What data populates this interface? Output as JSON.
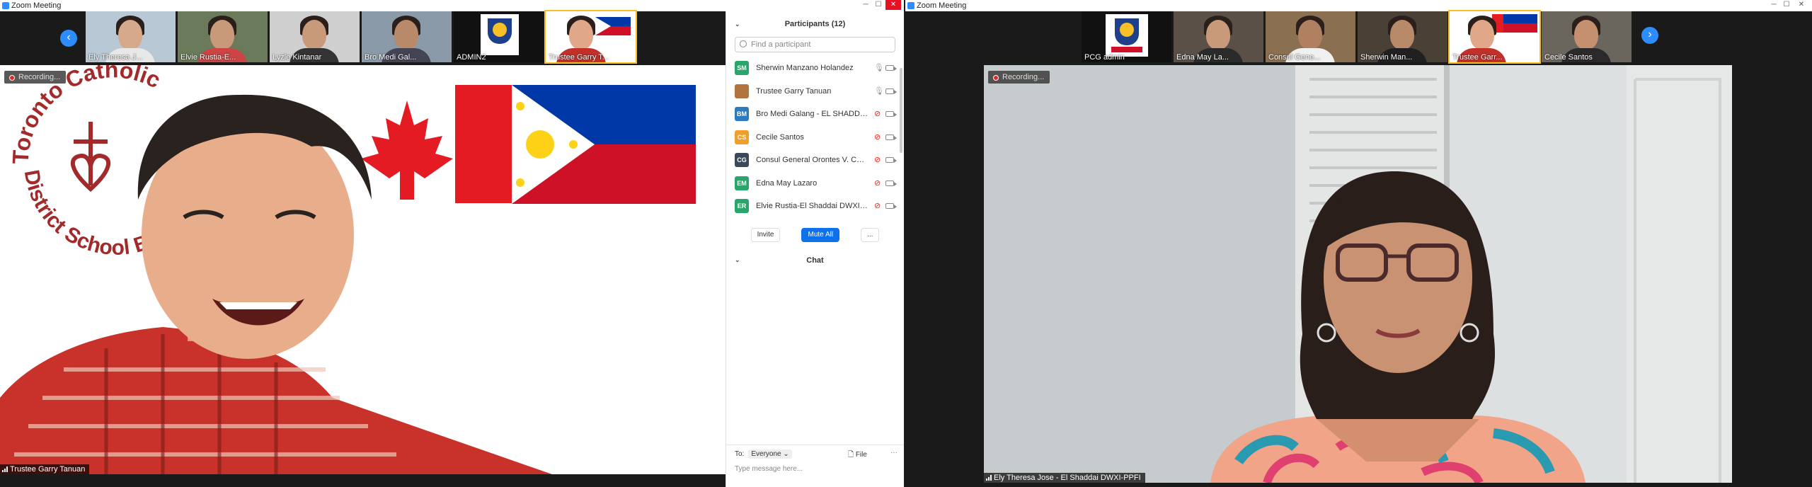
{
  "left_window": {
    "title": "Zoom Meeting",
    "thumbnails": [
      {
        "name": "Ely Theresa J..."
      },
      {
        "name": "Elvie Rustia-E..."
      },
      {
        "name": "Lyzle Kintanar"
      },
      {
        "name": "Bro Medi Gal..."
      },
      {
        "name": "ADMIN2"
      },
      {
        "name": "Trustee Garry T..."
      }
    ],
    "recording_label": "Recording...",
    "speaker_name": "Trustee Garry Tanuan",
    "background_logo_text": "Toronto Catholic District School Board",
    "nav_prev": "‹"
  },
  "participants_panel": {
    "title": "Participants (12)",
    "search_placeholder": "Find a participant",
    "participants": [
      {
        "initials": "SM",
        "name": "Sherwin Manzano Holandez",
        "color": "#2aa56b",
        "mic": "on"
      },
      {
        "initials": "",
        "name": "Trustee Garry Tanuan",
        "color": "#b3733f",
        "mic": "on"
      },
      {
        "initials": "BM",
        "name": "Bro Medi Galang - EL SHADDAI ...",
        "color": "#2b7bc2",
        "mic": "off"
      },
      {
        "initials": "CS",
        "name": "Cecile Santos",
        "color": "#f0a02a",
        "mic": "off"
      },
      {
        "initials": "CG",
        "name": "Consul General Orontes V. Cast...",
        "color": "#3a4a5a",
        "mic": "off"
      },
      {
        "initials": "EM",
        "name": "Edna May Lazaro",
        "color": "#2aa56b",
        "mic": "off"
      },
      {
        "initials": "ER",
        "name": "Elvie Rustia-El Shaddai DWXI-PPFI",
        "color": "#2aa56b",
        "mic": "off"
      }
    ],
    "invite_label": "Invite",
    "mute_all_label": "Mute All",
    "more_label": "...",
    "chat_title": "Chat",
    "chat_to_label": "To:",
    "chat_to_value": "Everyone",
    "file_label": "File",
    "chat_more": "···",
    "message_placeholder": "Type message here..."
  },
  "right_window": {
    "title": "Zoom Meeting",
    "thumbnails": [
      {
        "name": "PCG admin"
      },
      {
        "name": "Edna May La..."
      },
      {
        "name": "Consul Gene..."
      },
      {
        "name": "Sherwin Man..."
      },
      {
        "name": "Trustee Garr..."
      },
      {
        "name": "Cecile Santos"
      }
    ],
    "recording_label": "Recording...",
    "speaker_name": "Ely Theresa Jose - El Shaddai DWXI-PPFI",
    "nav_next": "›"
  }
}
